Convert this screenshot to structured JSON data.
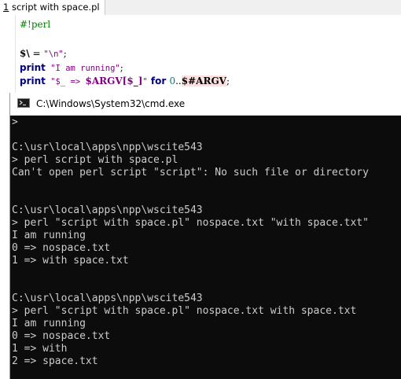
{
  "editor": {
    "tab": {
      "number": "1",
      "filename": " script with space.pl"
    },
    "code": {
      "line1": "#!perl",
      "line3": {
        "var": "$\\",
        "op": " = ",
        "str": "\"\\n\"",
        "end": ";"
      },
      "line4": {
        "kw": "print",
        "str": " \"I am running\"",
        "end": ";"
      },
      "line5": {
        "kw": "print",
        "str_a": " \"$_ => ",
        "arr": "$ARGV[$_]",
        "str_b": "\"",
        "kw_for": " for ",
        "num": "0",
        "op": "..",
        "var_hl": "$#ARGV",
        "end": ";"
      }
    }
  },
  "cmd": {
    "title": "C:\\Windows\\System32\\cmd.exe",
    "icon": "console-icon",
    "lines": [
      ">",
      "",
      "C:\\usr\\local\\apps\\npp\\wscite543",
      "> perl script with space.pl",
      "Can't open perl script \"script\": No such file or directory",
      "",
      "",
      "C:\\usr\\local\\apps\\npp\\wscite543",
      "> perl \"script with space.pl\" nospace.txt \"with space.txt\"",
      "I am running",
      "0 => nospace.txt",
      "1 => with space.txt",
      "",
      "",
      "C:\\usr\\local\\apps\\npp\\wscite543",
      "> perl \"script with space.pl\" nospace.txt with space.txt",
      "I am running",
      "0 => nospace.txt",
      "1 => with",
      "2 => space.txt"
    ]
  }
}
